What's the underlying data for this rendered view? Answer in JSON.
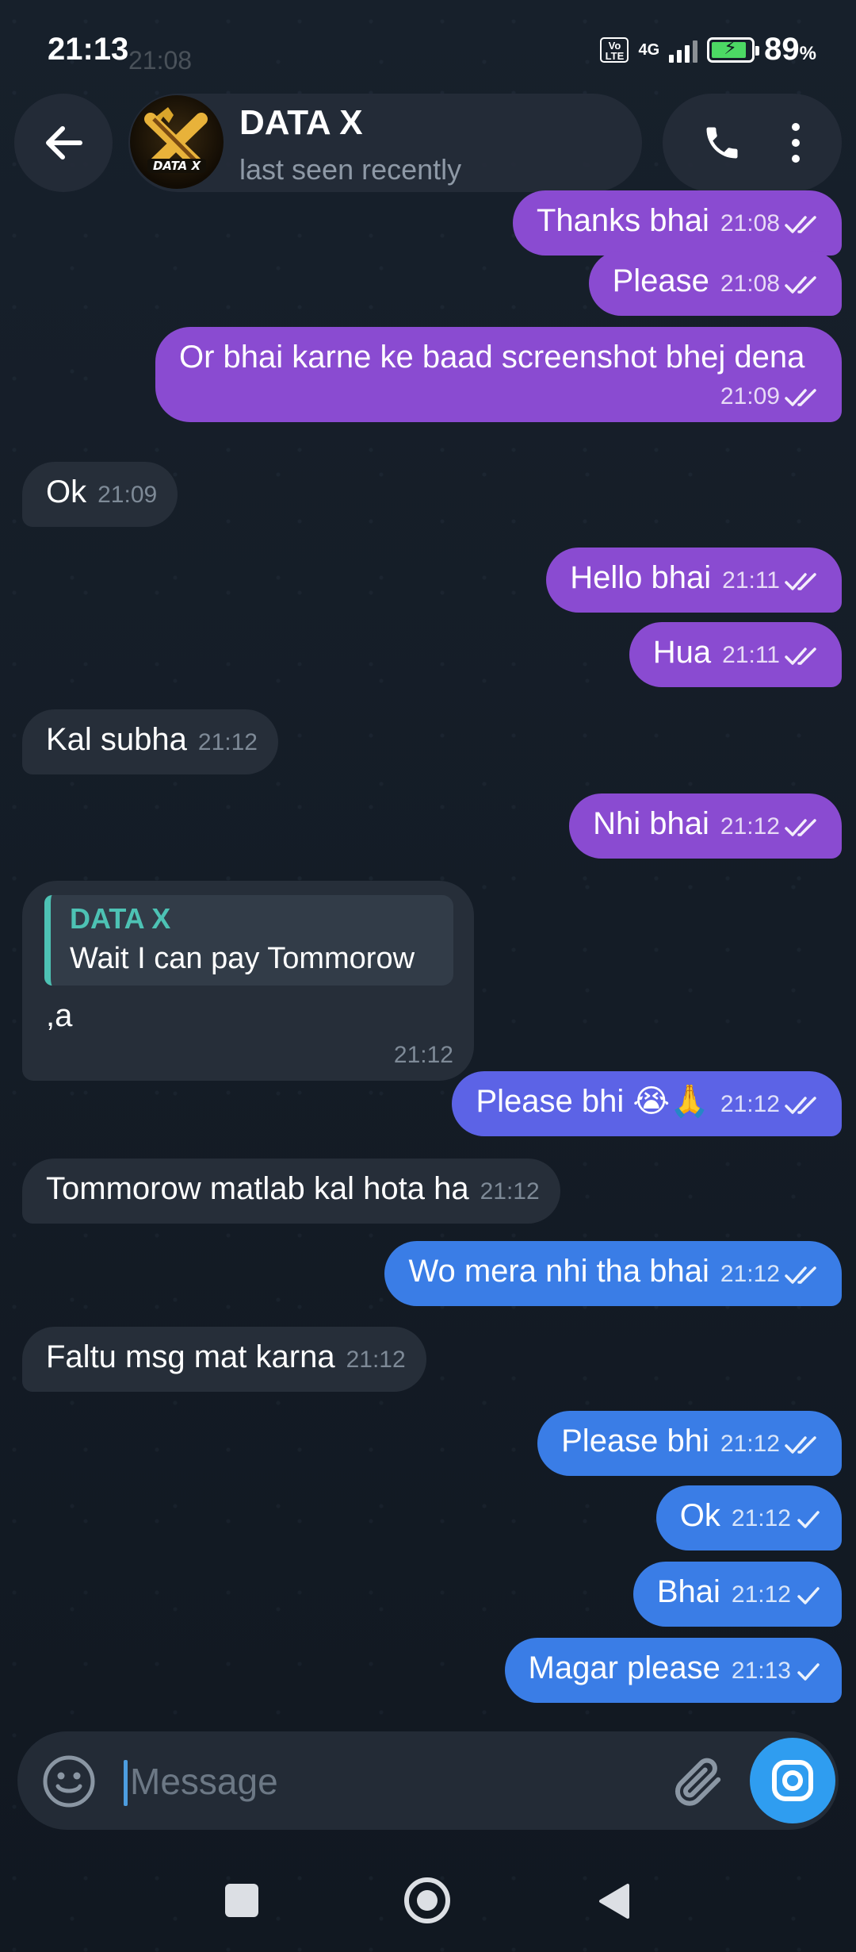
{
  "status_bar": {
    "time": "21:13",
    "ghost_time": "21:08",
    "volte": "Vo LTE",
    "network": "4G",
    "battery_percent": "89",
    "battery_unit": "%",
    "battery_level": 0.89
  },
  "header": {
    "title": "DATA X",
    "status": "last seen recently",
    "avatar_text": "DATA X"
  },
  "messages": [
    {
      "dir": "out",
      "text": "Thanks bhai",
      "time": "21:08",
      "ticks": "double"
    },
    {
      "dir": "out",
      "text": "Please",
      "time": "21:08",
      "ticks": "double"
    },
    {
      "dir": "out",
      "text": "Or bhai karne ke baad screenshot bhej dena",
      "time": "21:09",
      "ticks": "double"
    },
    {
      "dir": "in",
      "text": "Ok",
      "time": "21:09"
    },
    {
      "dir": "out",
      "text": "Hello bhai",
      "time": "21:11",
      "ticks": "double"
    },
    {
      "dir": "out",
      "text": "Hua",
      "time": "21:11",
      "ticks": "double"
    },
    {
      "dir": "in",
      "text": "Kal subha",
      "time": "21:12"
    },
    {
      "dir": "out",
      "text": "Nhi bhai",
      "time": "21:12",
      "ticks": "double"
    },
    {
      "dir": "in",
      "text": ",a",
      "time": "21:12",
      "reply": {
        "author": "DATA X",
        "text": "Wait I can pay Tommorow"
      }
    },
    {
      "dir": "out",
      "text": "Please bhi 😭🙏",
      "time": "21:12",
      "ticks": "double"
    },
    {
      "dir": "in",
      "text": "Tommorow matlab kal hota ha",
      "time": "21:12"
    },
    {
      "dir": "out",
      "text": "Wo mera nhi tha bhai",
      "time": "21:12",
      "ticks": "double"
    },
    {
      "dir": "in",
      "text": "Faltu msg mat karna",
      "time": "21:12"
    },
    {
      "dir": "out",
      "text": "Please bhi",
      "time": "21:12",
      "ticks": "double"
    },
    {
      "dir": "out",
      "text": "Ok",
      "time": "21:12",
      "ticks": "single"
    },
    {
      "dir": "out",
      "text": "Bhai",
      "time": "21:12",
      "ticks": "single"
    },
    {
      "dir": "out",
      "text": "Magar please",
      "time": "21:13",
      "ticks": "single"
    }
  ],
  "composer": {
    "placeholder": "Message"
  },
  "icons": {
    "back": "arrow-left-icon",
    "call": "phone-icon",
    "menu": "more-vertical-icon",
    "emoji": "smiley-icon",
    "attach": "paperclip-icon",
    "camera": "camera-icon"
  },
  "colors": {
    "outgoing_purple": "#8a4bd1",
    "outgoing_indigo": "#5c63e6",
    "outgoing_blue": "#3a7de6",
    "incoming": "#262e39",
    "reply_accent": "#4dc2b4",
    "camera_button": "#2f9df0"
  }
}
